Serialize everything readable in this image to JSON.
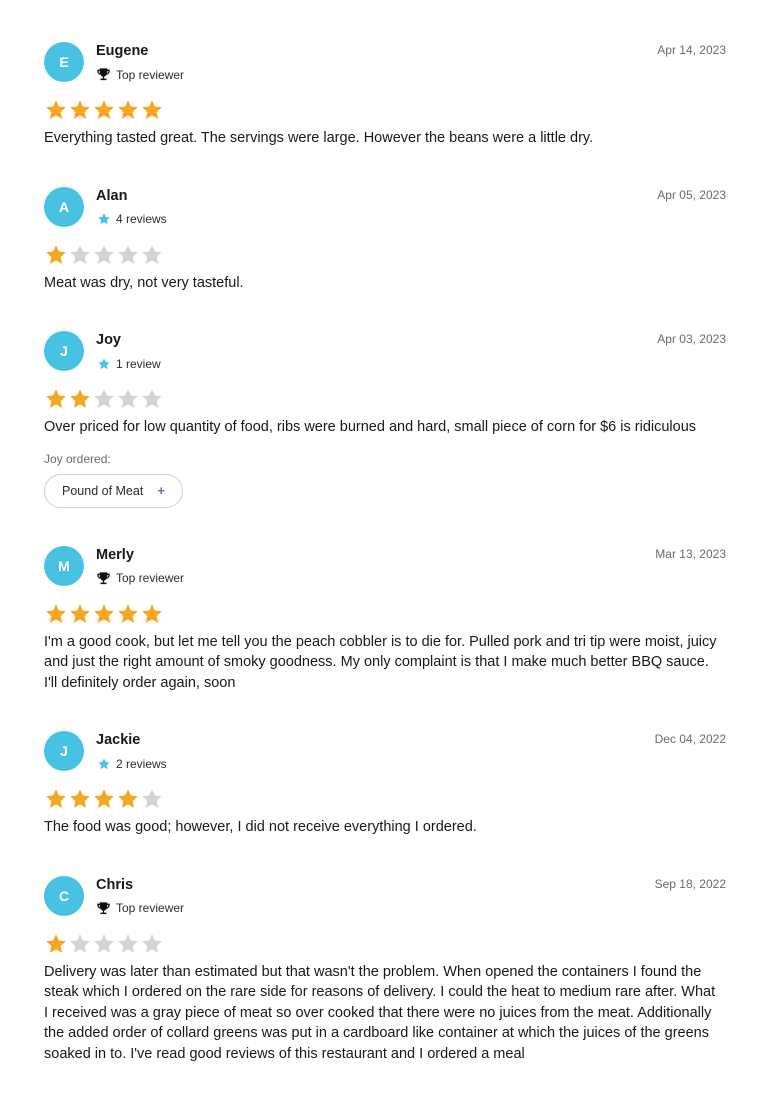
{
  "colors": {
    "avatar_bg": "#47c2e0",
    "star_filled": "#f5a623",
    "star_empty": "#d3d3d3",
    "reviews_star_icon": "#47c2e0",
    "plus_icon": "#6a62e0"
  },
  "reviews": [
    {
      "initial": "E",
      "name": "Eugene",
      "badge_icon": "trophy-icon",
      "badge_text": "Top reviewer",
      "date": "Apr 14, 2023",
      "rating": 5,
      "text": "Everything tasted great. The servings were large. However the beans were a little dry."
    },
    {
      "initial": "A",
      "name": "Alan",
      "badge_icon": "star-icon",
      "badge_text": "4 reviews",
      "date": "Apr 05, 2023",
      "rating": 1,
      "text": "Meat was dry, not very tasteful."
    },
    {
      "initial": "J",
      "name": "Joy",
      "badge_icon": "star-icon",
      "badge_text": "1 review",
      "date": "Apr 03, 2023",
      "rating": 2,
      "text": "Over priced for low quantity of food, ribs were burned and hard, small piece of corn for $6 is ridiculous",
      "ordered_label": "Joy ordered:",
      "ordered_items": [
        "Pound of Meat"
      ]
    },
    {
      "initial": "M",
      "name": "Merly",
      "badge_icon": "trophy-icon",
      "badge_text": "Top reviewer",
      "date": "Mar 13, 2023",
      "rating": 5,
      "text": "I'm a good cook, but let me tell you the peach cobbler is to die for. Pulled pork and tri tip were moist, juicy and just the right amount of smoky goodness. My only complaint is that I make much better BBQ sauce. I'll definitely order again, soon"
    },
    {
      "initial": "J",
      "name": "Jackie",
      "badge_icon": "star-icon",
      "badge_text": "2 reviews",
      "date": "Dec 04, 2022",
      "rating": 4,
      "text": "The food was good; however, I did not receive everything I ordered."
    },
    {
      "initial": "C",
      "name": "Chris",
      "badge_icon": "trophy-icon",
      "badge_text": "Top reviewer",
      "date": "Sep 18, 2022",
      "rating": 1,
      "text": "Delivery was later than estimated but that wasn't the problem. When opened the containers I found the steak which I ordered on the rare side for reasons of delivery. I could the heat to medium rare after. What I received was a gray piece of meat so over cooked that there were no juices from the meat. Additionally the added order of collard greens was put in a cardboard like container at which the juices of the greens soaked in to. I've read good reviews of this restaurant and I ordered a meal"
    }
  ]
}
